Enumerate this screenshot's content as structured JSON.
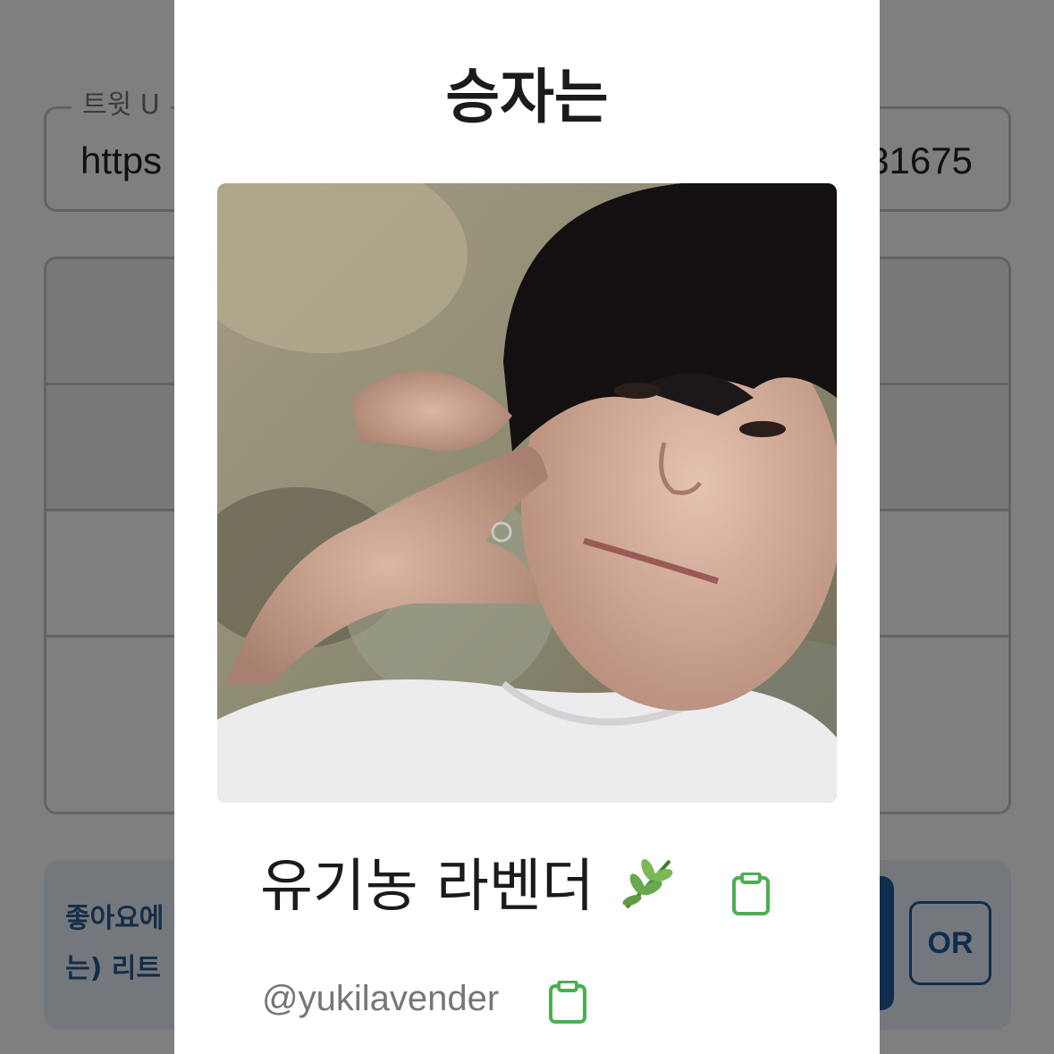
{
  "background": {
    "url_field": {
      "legend": "트윗 U",
      "value": "https",
      "value_end": "31675"
    },
    "info_box": {
      "line1": "좋아요에",
      "line2": "는) 리트"
    },
    "or_button": "OR"
  },
  "modal": {
    "title": "승자는",
    "winner": {
      "name": "유기농 라벤더",
      "name_emoji": "herb-emoji",
      "handle": "@yukilavender"
    }
  },
  "icons": {
    "copy": "clipboard-icon",
    "copy_color": "#4caf50"
  }
}
